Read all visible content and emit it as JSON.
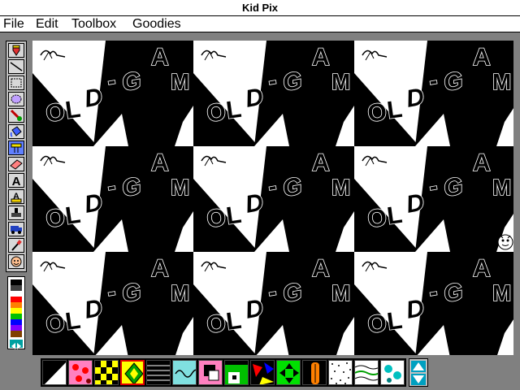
{
  "window": {
    "title": "Kid Pix"
  },
  "menu": [
    {
      "label": "File"
    },
    {
      "label": "Edit"
    },
    {
      "label": "Toolbox"
    },
    {
      "label": "Goodies"
    }
  ],
  "tools": [
    {
      "name": "wacky-pencil-tool-icon"
    },
    {
      "name": "line-tool-icon"
    },
    {
      "name": "rectangle-tool-icon"
    },
    {
      "name": "oval-tool-icon"
    },
    {
      "name": "wacky-brush-tool-icon"
    },
    {
      "name": "paint-can-tool-icon"
    },
    {
      "name": "electric-mixer-tool-icon",
      "selected": true
    },
    {
      "name": "eraser-tool-icon"
    },
    {
      "name": "text-tool-icon"
    },
    {
      "name": "alphabet-stamp-tool-icon"
    },
    {
      "name": "rubber-stamp-tool-icon"
    },
    {
      "name": "moving-van-tool-icon"
    },
    {
      "name": "eyedropper-tool-icon"
    },
    {
      "name": "undo-guy-tool-icon"
    }
  ],
  "palette": {
    "colors": [
      "#000000",
      "#404040",
      "#ffffff",
      "#ff0000",
      "#ff8000",
      "#ffff00",
      "#00c000",
      "#0000ff",
      "#8000ff",
      "#804000"
    ]
  },
  "canvas": {
    "stamp_letters": {
      "first": "O",
      "second": "L",
      "third": "D",
      "dash": "-",
      "g": "G",
      "a": "A",
      "m": "M"
    }
  },
  "options": [
    {
      "name": "triangle-option-icon"
    },
    {
      "name": "pink-dots-option-icon"
    },
    {
      "name": "checker-option-icon"
    },
    {
      "name": "diamond-option-icon",
      "selected": true
    },
    {
      "name": "stripes-option-icon"
    },
    {
      "name": "squiggle-option-icon"
    },
    {
      "name": "pink-grid-option-icon"
    },
    {
      "name": "green-blocks-option-icon"
    },
    {
      "name": "shards-option-icon"
    },
    {
      "name": "arrows-option-icon"
    },
    {
      "name": "orange-bar-option-icon"
    },
    {
      "name": "speckle-option-icon"
    },
    {
      "name": "waves-option-icon"
    },
    {
      "name": "bubbles-option-icon"
    }
  ]
}
